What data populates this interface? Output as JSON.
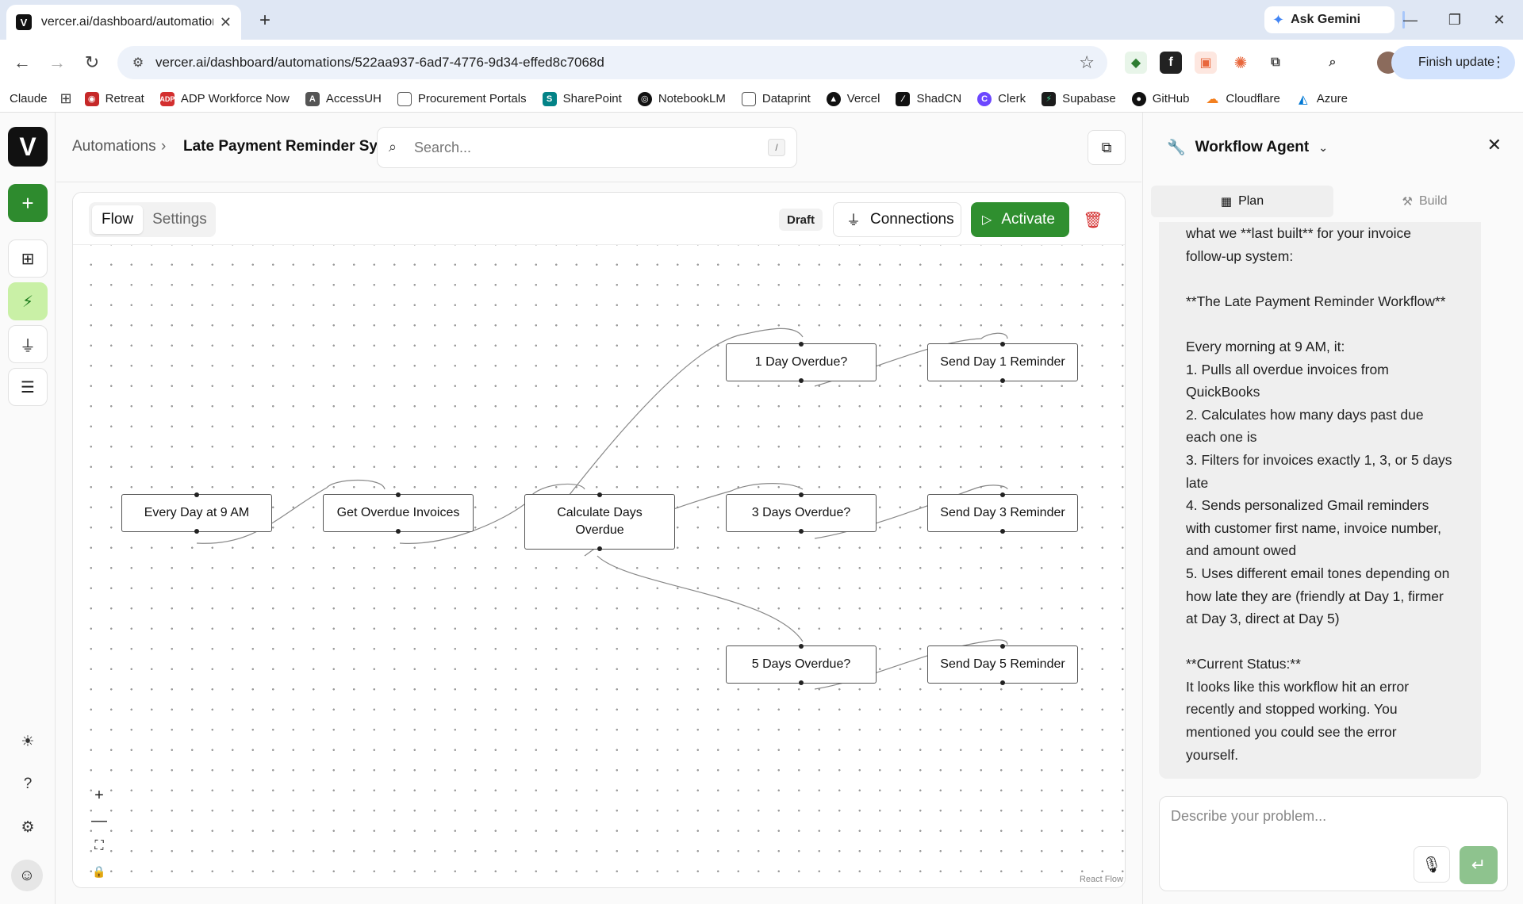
{
  "browser": {
    "tab_title": "vercer.ai/dashboard/automation",
    "url": "vercer.ai/dashboard/automations/522aa937-6ad7-4776-9d34-effed8c7068d",
    "gemini_label": "Ask Gemini",
    "finish_update_label": "Finish update",
    "bookmarks": [
      "Claude",
      "Retreat",
      "ADP Workforce Now",
      "AccessUH",
      "Procurement Portals",
      "SharePoint",
      "NotebookLM",
      "Dataprint",
      "Vercel",
      "ShadCN",
      "Clerk",
      "Supabase",
      "GitHub",
      "Cloudflare",
      "Azure"
    ]
  },
  "app": {
    "breadcrumb_root": "Automations",
    "breadcrumb_current": "Late Payment Reminder System",
    "search_placeholder": "Search...",
    "search_shortcut": "/"
  },
  "canvas": {
    "tabs": [
      "Flow",
      "Settings"
    ],
    "active_tab": "Flow",
    "status_badge": "Draft",
    "connections_label": "Connections",
    "activate_label": "Activate",
    "attribution": "React Flow",
    "nodes": [
      {
        "id": "trigger",
        "label": "Every Day at 9 AM"
      },
      {
        "id": "get",
        "label": "Get Overdue Invoices"
      },
      {
        "id": "calc",
        "label": "Calculate Days Overdue"
      },
      {
        "id": "d1",
        "label": "1 Day Overdue?"
      },
      {
        "id": "d3",
        "label": "3 Days Overdue?"
      },
      {
        "id": "d5",
        "label": "5 Days Overdue?"
      },
      {
        "id": "s1",
        "label": "Send Day 1 Reminder"
      },
      {
        "id": "s3",
        "label": "Send Day 3 Reminder"
      },
      {
        "id": "s5",
        "label": "Send Day 5 Reminder"
      }
    ]
  },
  "agent": {
    "title": "Workflow Agent",
    "tabs": [
      "Plan",
      "Build"
    ],
    "active_tab": "Plan",
    "message": "what we **last built** for your invoice\nfollow-up system:\n\n**The Late Payment Reminder Workflow**\n\nEvery morning at 9 AM, it:\n1. Pulls all overdue invoices from\nQuickBooks\n2. Calculates how many days past due\neach one is\n3. Filters for invoices exactly 1, 3, or 5 days\nlate\n4. Sends personalized Gmail reminders\nwith customer first name, invoice number,\nand amount owed\n5. Uses different email tones depending on\nhow late they are (friendly at Day 1, firmer\nat Day 3, direct at Day 5)\n\n**Current Status:**\nIt looks like this workflow hit an error\nrecently and stopped working. You\nmentioned you could see the error\nyourself.",
    "input_placeholder": "Describe your problem..."
  }
}
